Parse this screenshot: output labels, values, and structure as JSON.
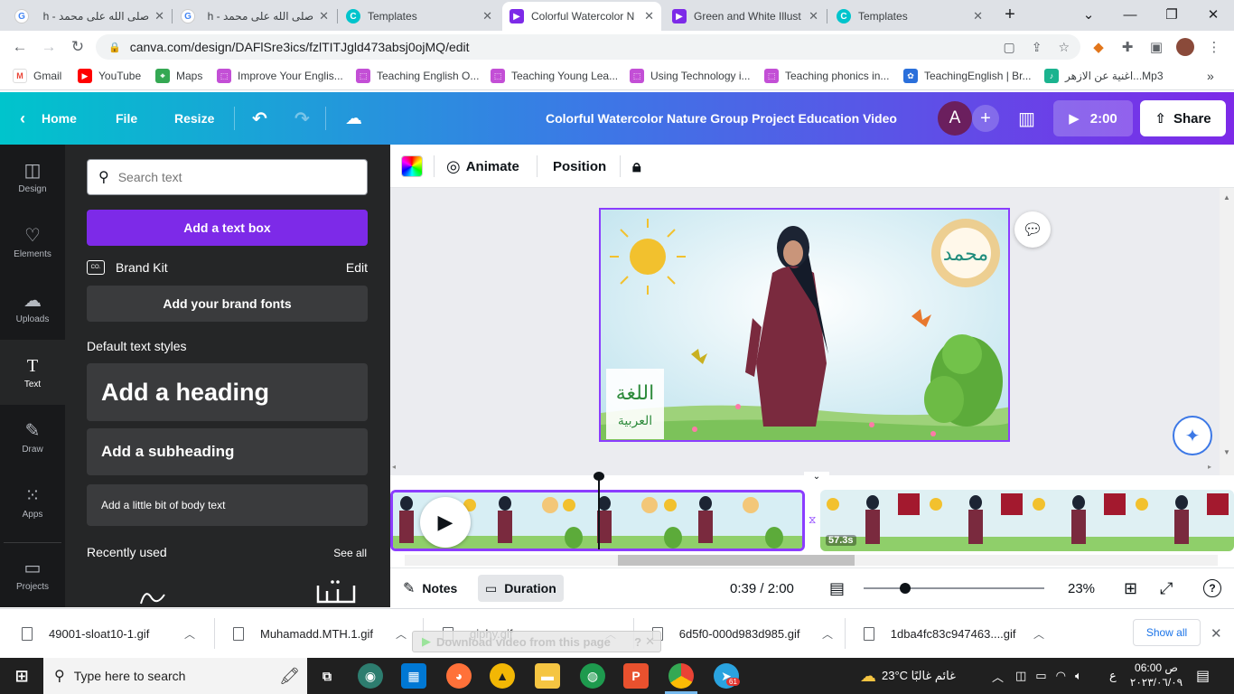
{
  "browser": {
    "tabs": [
      {
        "title": "صلى الله على محمد - h",
        "icon": "google-icon",
        "active": false
      },
      {
        "title": "صلى الله على محمد - h",
        "icon": "google-icon",
        "active": false
      },
      {
        "title": "Templates",
        "icon": "canva-icon",
        "active": false
      },
      {
        "title": "Colorful Watercolor N",
        "icon": "canva-video-icon",
        "active": true
      },
      {
        "title": "Green and White Illust",
        "icon": "canva-video-icon",
        "active": false
      },
      {
        "title": "Templates",
        "icon": "canva-icon",
        "active": false
      }
    ],
    "url": "canva.com/design/DAFlSre3ics/fzlTITJgld473absj0ojMQ/edit",
    "bookmarks": [
      "Gmail",
      "YouTube",
      "Maps",
      "Improve Your Englis...",
      "Teaching English O...",
      "Teaching Young Lea...",
      "Using Technology i...",
      "Teaching phonics in...",
      "TeachingEnglish | Br...",
      "Mp3...اغنية عن الازهر"
    ]
  },
  "header": {
    "home": "Home",
    "file": "File",
    "resize": "Resize",
    "title": "Colorful  Watercolor Nature  Group Project Education Video",
    "avatar_letter": "A",
    "duration": "2:00",
    "share": "Share"
  },
  "rail": [
    {
      "label": "Design",
      "icon": "design-icon"
    },
    {
      "label": "Elements",
      "icon": "elements-icon"
    },
    {
      "label": "Uploads",
      "icon": "uploads-icon"
    },
    {
      "label": "Text",
      "icon": "text-icon"
    },
    {
      "label": "Draw",
      "icon": "draw-icon"
    },
    {
      "label": "Apps",
      "icon": "apps-icon"
    },
    {
      "label": "Projects",
      "icon": "projects-icon"
    }
  ],
  "panel": {
    "search_placeholder": "Search text",
    "add_text_box": "Add a text box",
    "brand_kit": "Brand Kit",
    "brand_kit_badge": "CO.",
    "edit": "Edit",
    "add_brand_fonts": "Add your brand fonts",
    "default_styles": "Default text styles",
    "heading": "Add a heading",
    "subheading": "Add a subheading",
    "body": "Add a little bit of body text",
    "recently_used": "Recently used",
    "see_all": "See all"
  },
  "toolbar": {
    "animate": "Animate",
    "position": "Position"
  },
  "timeline": {
    "clip_duration": "57.3s"
  },
  "footer": {
    "notes": "Notes",
    "duration": "Duration",
    "time": "0:39 / 2:00",
    "zoom": "23%",
    "zoom_level": 0.23
  },
  "downloads": [
    "49001-sloat10-1.gif",
    "Muhamadd.MTH.1.gif",
    "giphy.gif",
    "6d5f0-000d983d985.gif",
    "1dba4fc83c947463....gif"
  ],
  "downloads_show_all": "Show all",
  "download_overlay": "Download video from this page",
  "taskbar": {
    "search_placeholder": "Type here to search",
    "weather": "23°C  غائم غالبًا",
    "time": "06:00 ص",
    "date": "٢٠٢٣/٠٦/٠٩",
    "lang": "ع",
    "telegram_badge": "61"
  }
}
